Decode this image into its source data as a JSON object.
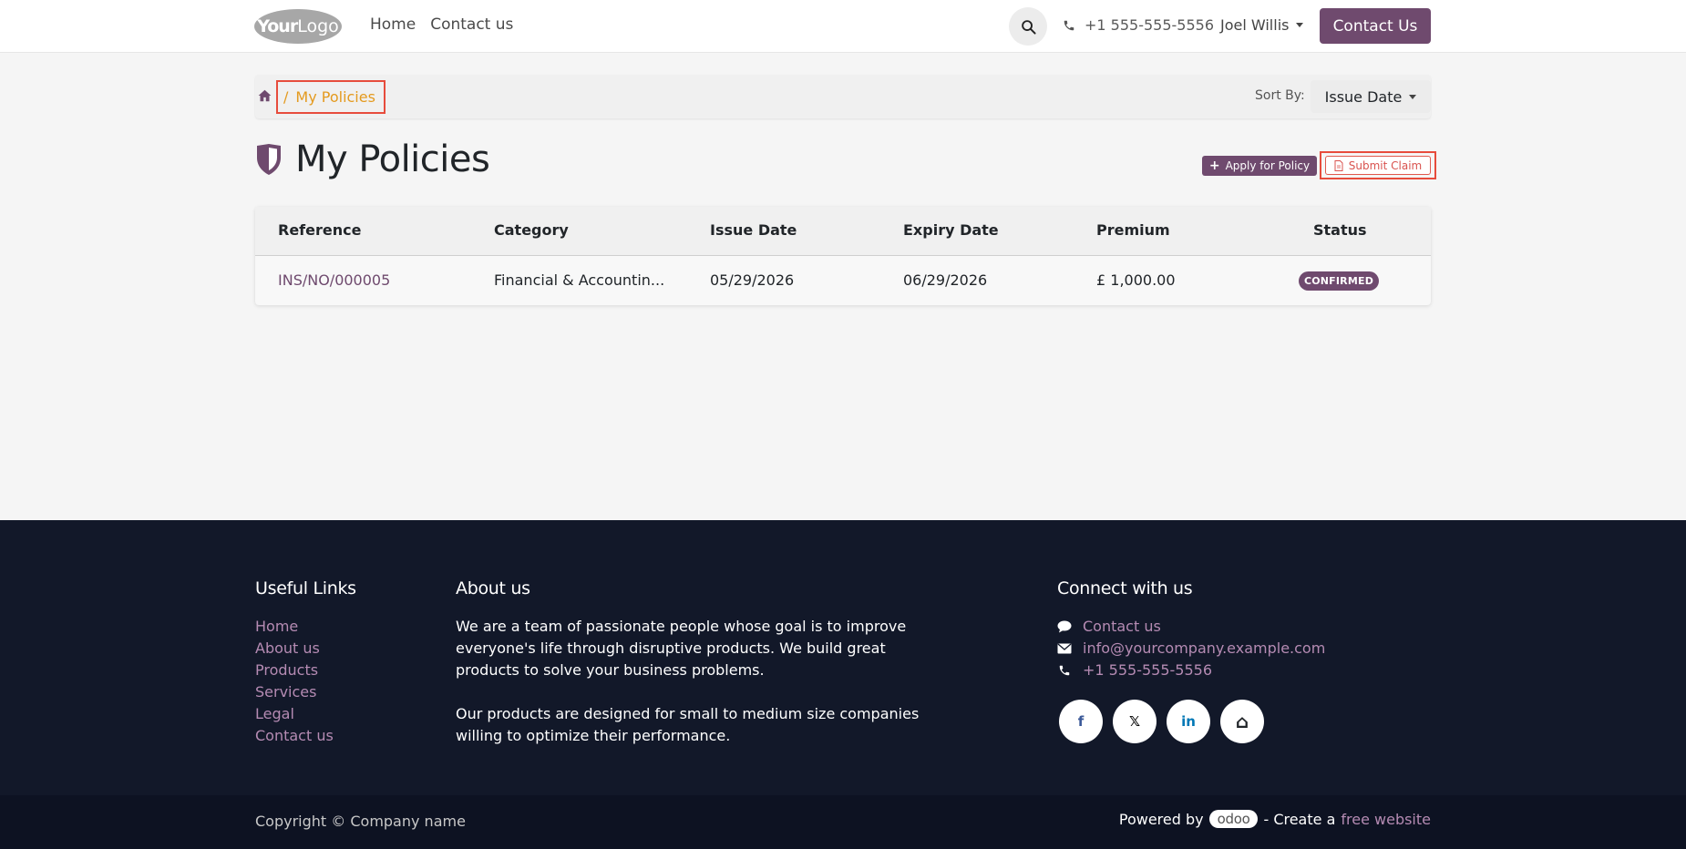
{
  "header": {
    "logo_bold": "Your",
    "logo_light": "Logo",
    "nav": [
      {
        "label": "Home"
      },
      {
        "label": "Contact us"
      }
    ],
    "phone": "+1 555-555-5556",
    "user": "Joel Willis",
    "contact_button": "Contact Us"
  },
  "breadcrumb": {
    "separator": "/",
    "current": "My Policies"
  },
  "sort": {
    "label": "Sort By:",
    "value": "Issue Date"
  },
  "page": {
    "title": "My Policies",
    "apply_button": "Apply for Policy",
    "claim_button": "Submit Claim"
  },
  "table": {
    "headers": [
      "Reference",
      "Category",
      "Issue Date",
      "Expiry Date",
      "Premium",
      "Status"
    ],
    "rows": [
      {
        "reference": "INS/NO/000005",
        "category": "Financial & Accountin...",
        "issue_date": "05/29/2026",
        "expiry_date": "06/29/2026",
        "premium": "£ 1,000.00",
        "status": "CONFIRMED"
      }
    ]
  },
  "footer": {
    "useful_links_title": "Useful Links",
    "useful_links": [
      "Home",
      "About us",
      "Products",
      "Services",
      "Legal",
      "Contact us"
    ],
    "about_title": "About us",
    "about_p1": "We are a team of passionate people whose goal is to improve everyone's life through disruptive products. We build great products to solve your business problems.",
    "about_p2": "Our products are designed for small to medium size companies willing to optimize their performance.",
    "connect_title": "Connect with us",
    "connect_contact": "Contact us",
    "connect_email": "info@yourcompany.example.com",
    "connect_phone": "+1 555-555-5556",
    "socials": [
      {
        "icon": "facebook-icon",
        "glyph": "f",
        "color": "#3b5998"
      },
      {
        "icon": "x-icon",
        "glyph": "𝕏",
        "color": "#000000"
      },
      {
        "icon": "linkedin-icon",
        "glyph": "in",
        "color": "#0077b5"
      },
      {
        "icon": "home-icon",
        "glyph": "⌂",
        "color": "#212529"
      }
    ],
    "copyright": "Copyright © Company name",
    "powered_by": "Powered by",
    "odoo": "odoo",
    "create_a": "- Create a",
    "free_website": "free website"
  },
  "colors": {
    "brand": "#6f4a6e",
    "breadcrumb_active": "#e49a1e",
    "footer_bg": "#121829",
    "footer_link": "#b58bb3",
    "highlight_border": "#e74c3c"
  }
}
